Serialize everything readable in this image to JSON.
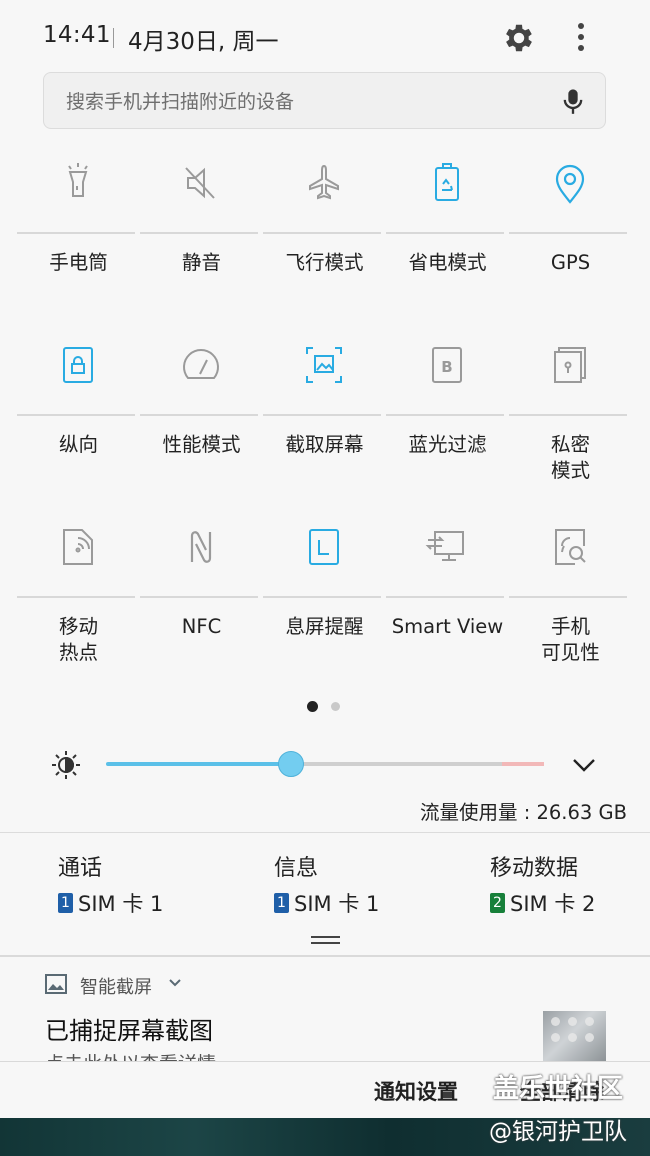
{
  "status_bar": {
    "time": "14:41",
    "date": "4月30日, 周一"
  },
  "search": {
    "placeholder": "搜索手机并扫描附近的设备"
  },
  "colors": {
    "accent": "#29abe2",
    "icon_gray": "#9a9a9a",
    "sim1": "#1f5fa8",
    "sim2": "#17803a"
  },
  "tiles": [
    {
      "label": "手电筒",
      "icon": "flashlight-icon",
      "active": false
    },
    {
      "label": "静音",
      "icon": "mute-icon",
      "active": false
    },
    {
      "label": "飞行模式",
      "icon": "airplane-icon",
      "active": false
    },
    {
      "label": "省电模式",
      "icon": "battery-saver-icon",
      "active": true
    },
    {
      "label": "GPS",
      "icon": "location-pin-icon",
      "active": true
    },
    {
      "label": "纵向",
      "icon": "portrait-lock-icon",
      "active": true
    },
    {
      "label": "性能模式",
      "icon": "speedometer-icon",
      "active": false
    },
    {
      "label": "截取屏幕",
      "icon": "screenshot-icon",
      "active": true
    },
    {
      "label": "蓝光过滤",
      "icon": "blue-light-filter-icon",
      "active": false
    },
    {
      "label": "私密\n模式",
      "icon": "private-mode-icon",
      "active": false
    },
    {
      "label": "移动\n热点",
      "icon": "hotspot-icon",
      "active": false
    },
    {
      "label": "NFC",
      "icon": "nfc-icon",
      "active": false
    },
    {
      "label": "息屏提醒",
      "icon": "always-on-display-icon",
      "active": true
    },
    {
      "label": "Smart View",
      "icon": "smart-view-icon",
      "active": false
    },
    {
      "label": "手机\n可见性",
      "icon": "device-visibility-icon",
      "active": false
    }
  ],
  "pager": {
    "pages": 2,
    "current": 1
  },
  "brightness": {
    "level": 0.42
  },
  "data_usage": "流量使用量 : 26.63 GB",
  "sim": [
    {
      "title": "通话",
      "badge": "1",
      "value": "SIM 卡 1"
    },
    {
      "title": "信息",
      "badge": "1",
      "value": "SIM 卡 1"
    },
    {
      "title": "移动数据",
      "badge": "2",
      "value": "SIM 卡 2"
    }
  ],
  "notification": {
    "app": "智能截屏",
    "title": "已捕捉屏幕截图",
    "text": "点击此处以查看详情"
  },
  "bottom": {
    "settings": "通知设置",
    "clear": "全部清除"
  },
  "watermark": {
    "line1": "盖乐世社区",
    "line2": "@银河护卫队"
  }
}
